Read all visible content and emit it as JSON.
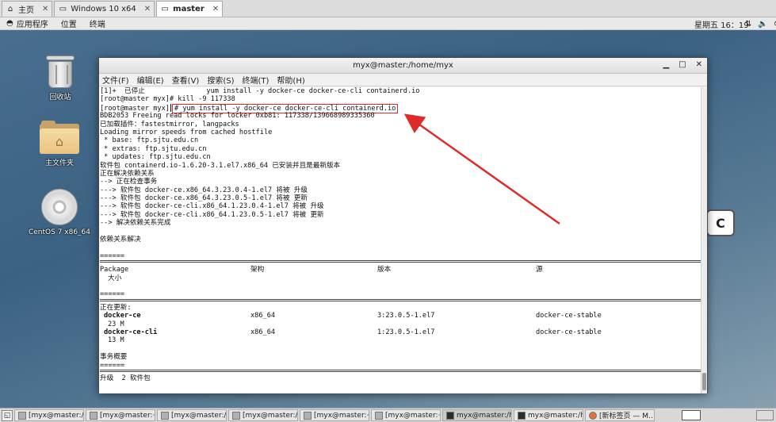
{
  "vm_tabs": [
    {
      "label": "主页",
      "icon": "home-icon"
    },
    {
      "label": "Windows 10 x64",
      "icon": "vm-icon"
    },
    {
      "label": "master",
      "icon": "vm-icon",
      "active": true
    }
  ],
  "gnome_bar": {
    "applications": "应用程序",
    "places": "位置",
    "terminal": "终端",
    "clock": "星期五 16：19"
  },
  "desktop_icons": [
    {
      "label": "回收站",
      "icon": "trash-icon"
    },
    {
      "label": "主文件夹",
      "icon": "home-folder-icon"
    },
    {
      "label": "CentOS 7 x86_64",
      "icon": "cd-icon"
    }
  ],
  "terminal": {
    "title": "myx@master:/home/myx",
    "menu": [
      "文件(F)",
      "编辑(E)",
      "查看(V)",
      "搜索(S)",
      "终端(T)",
      "帮助(H)"
    ],
    "lines": [
      "[1]+  已停止               yum install -y docker-ce docker-ce-cli containerd.io",
      "[root@master myx]# kill -9 117338",
      "BDB2053 Freeing read locks for locker 0xb81: 117338/139668989335360",
      "已加载插件：fastestmirror, langpacks",
      "Loading mirror speeds from cached hostfile",
      " * base: ftp.sjtu.edu.cn",
      " * extras: ftp.sjtu.edu.cn",
      " * updates: ftp.sjtu.edu.cn",
      "软件包 containerd.io-1.6.20-3.1.el7.x86_64 已安装并且是最新版本",
      "正在解决依赖关系",
      "--> 正在检查事务",
      "---> 软件包 docker-ce.x86_64.3.23.0.4-1.el7 将被 升级",
      "---> 软件包 docker-ce.x86_64.3.23.0.5-1.el7 将被 更新",
      "---> 软件包 docker-ce-cli.x86_64.1.23.0.4-1.el7 将被 升级",
      "---> 软件包 docker-ce-cli.x86_64.1.23.0.5-1.el7 将被 更新",
      "--> 解决依赖关系完成",
      "",
      "依赖关系解决"
    ],
    "highlighted_prompt": "[root@master myx]",
    "highlighted_command": "# yum install -y docker-ce docker-ce-cli containerd.io",
    "table": {
      "headers": {
        "package": "Package",
        "size": "大小",
        "arch": "架构",
        "version": "版本",
        "repo": "源"
      },
      "updating_label": "正在更新:",
      "rows": [
        {
          "name": "docker-ce",
          "arch": "x86_64",
          "version": "3:23.0.5-1.el7",
          "repo": "docker-ce-stable",
          "size": "23 M"
        },
        {
          "name": "docker-ce-cli",
          "arch": "x86_64",
          "version": "1:23.0.5-1.el7",
          "repo": "docker-ce-stable",
          "size": "13 M"
        }
      ],
      "summary_label": "事务概要",
      "upgrade_line": "升级  2 软件包"
    }
  },
  "taskbar": [
    {
      "label": "[myx@master:/o…",
      "icon": "terminal-icon"
    },
    {
      "label": "[myx@master:~]",
      "icon": "terminal-icon"
    },
    {
      "label": "[myx@master:/o…",
      "icon": "terminal-icon"
    },
    {
      "label": "[myx@master:/o…",
      "icon": "terminal-icon"
    },
    {
      "label": "[myx@master:~]",
      "icon": "terminal-icon"
    },
    {
      "label": "[myx@master:~]",
      "icon": "terminal-icon"
    },
    {
      "label": "myx@master:/ho…",
      "icon": "terminal-icon",
      "active": true
    },
    {
      "label": "myx@master:/ho…",
      "icon": "terminal-icon"
    },
    {
      "label": "[新标签页 — M…",
      "icon": "firefox-icon"
    }
  ],
  "colors": {
    "annotation": "#e02b2b",
    "desktop": "#3b6183"
  }
}
